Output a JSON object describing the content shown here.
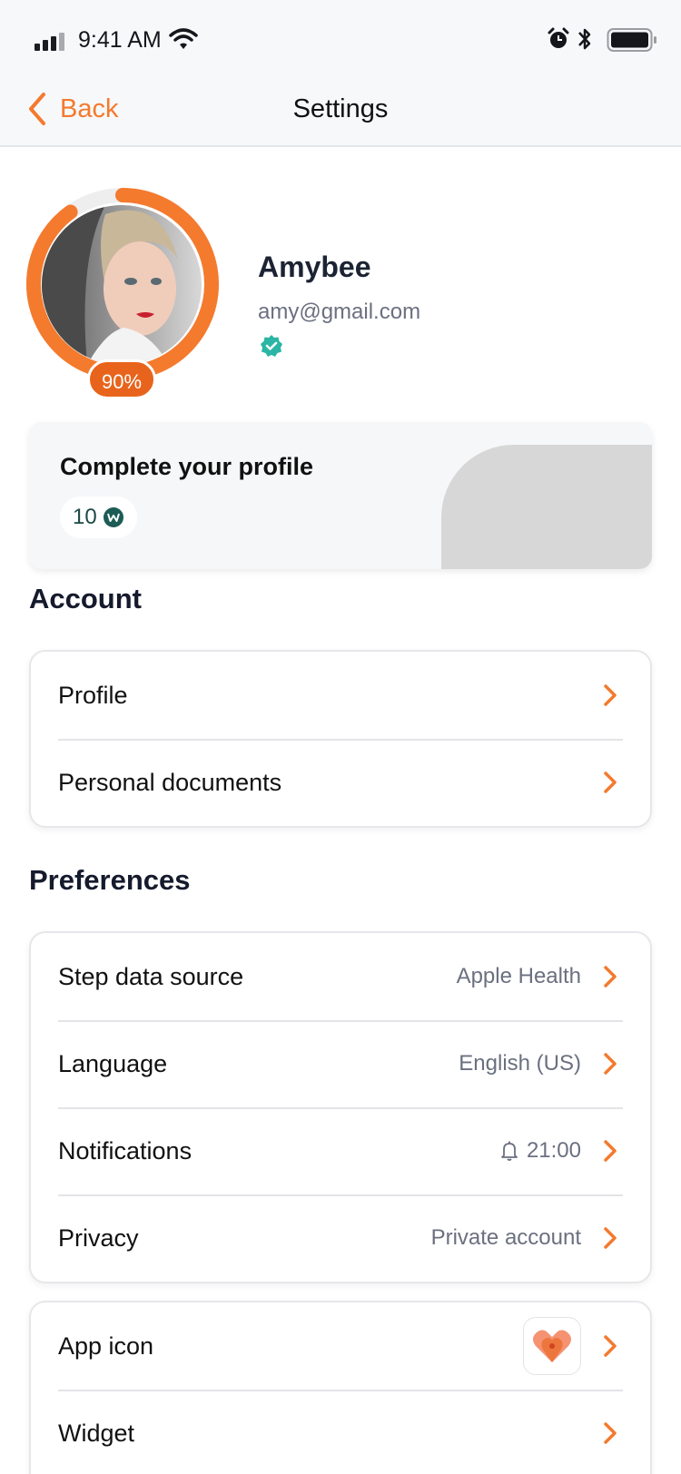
{
  "status_bar": {
    "time": "9:41 AM"
  },
  "nav": {
    "back_label": "Back",
    "title": "Settings"
  },
  "profile": {
    "name": "Amybee",
    "email": "amy@gmail.com",
    "completion_percent_label": "90%",
    "completion_fraction": 0.9,
    "verified": true
  },
  "complete_card": {
    "title": "Complete your profile",
    "reward_points": "10"
  },
  "account": {
    "title": "Account",
    "rows": [
      {
        "label": "Profile"
      },
      {
        "label": "Personal documents"
      }
    ]
  },
  "preferences": {
    "title": "Preferences",
    "rows": [
      {
        "label": "Step data source",
        "value": "Apple Health"
      },
      {
        "label": "Language",
        "value": "English (US)"
      },
      {
        "label": "Notifications",
        "value": "21:00",
        "icon": "bell-icon"
      },
      {
        "label": "Privacy",
        "value": "Private account"
      }
    ]
  },
  "more": {
    "rows": [
      {
        "label": "App icon",
        "icon": "heart-location-icon"
      },
      {
        "label": "Widget"
      }
    ]
  },
  "colors": {
    "accent": "#f47a2d",
    "badge": "#e8641c",
    "verified": "#2bb5a5",
    "coin": "#1c5c55"
  }
}
